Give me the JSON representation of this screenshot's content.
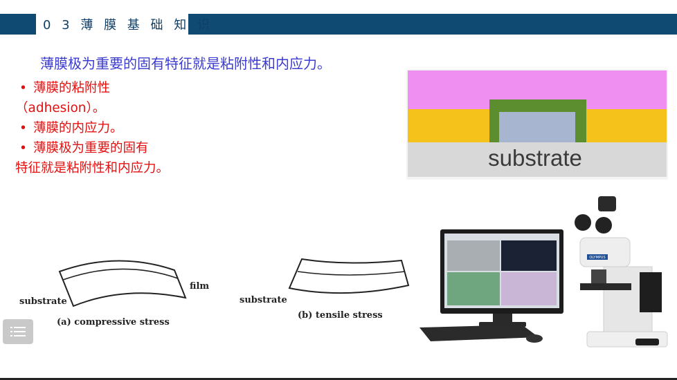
{
  "header": {
    "title": "0 3 薄 膜 基 础 知 识"
  },
  "lead_text": "薄膜极为重要的固有特征就是粘附性和内应力。",
  "bullets": [
    {
      "dot": "•",
      "line1": "薄膜的粘附性",
      "line2": "（adhesion）。"
    },
    {
      "dot": "•",
      "line1": "薄膜的内应力。"
    },
    {
      "dot": "•",
      "line1": "薄膜极为重要的固有",
      "line2": "特征就是粘附性和内应力。"
    }
  ],
  "film_diagram": {
    "substrate_label": "substrate",
    "colors": {
      "top": "#ef8ff2",
      "middle": "#f4c21a",
      "feature_border": "#5c8d2f",
      "feature_fill": "#a7b5d1",
      "substrate": "#d8d8d8"
    }
  },
  "stress_figures": {
    "compressive": {
      "substrate_label": "substrate",
      "film_label": "film",
      "caption": "(a) compressive stress"
    },
    "tensile": {
      "substrate_label": "substrate",
      "caption": "(b) tensile stress"
    }
  },
  "microscope": {
    "brand": "OLYMPUS"
  },
  "menu_button": {
    "icon": "menu-icon"
  }
}
